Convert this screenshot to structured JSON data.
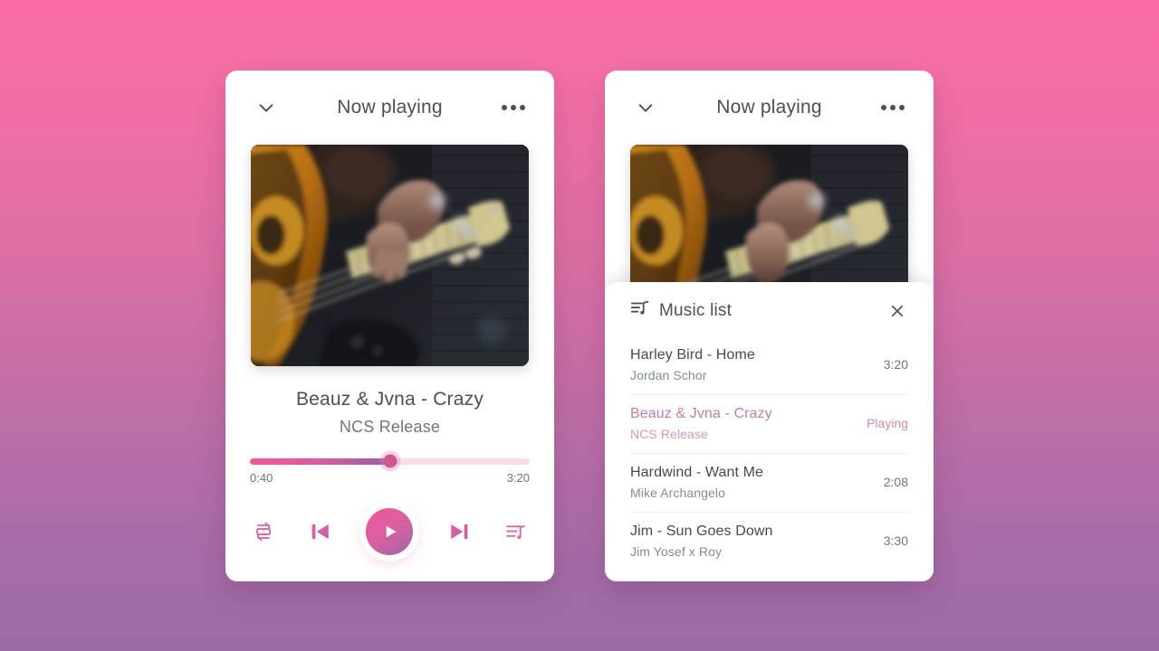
{
  "background": {
    "gradient_from": "#fa6ea5",
    "gradient_to": "#9b6ca9"
  },
  "accent": {
    "pink": "#f8569a",
    "purple": "#9b5fa6",
    "playing": "#c17fa5"
  },
  "player": {
    "header": {
      "title": "Now playing",
      "collapse_icon": "chevron-down-icon",
      "more_icon": "more-options-icon"
    },
    "album_art_alt": "bass-guitar-photo",
    "track": {
      "title": "Beauz & Jvna - Crazy",
      "artist": "NCS Release"
    },
    "progress": {
      "elapsed": "0:40",
      "duration": "3:20",
      "percent": 50
    },
    "controls": {
      "repeat_label": "repeat-one",
      "previous_label": "skip-previous",
      "play_label": "play",
      "next_label": "skip-next",
      "playlist_label": "playlist"
    }
  },
  "music_list": {
    "title": "Music list",
    "icon": "queue-music-icon",
    "close_icon": "close-icon",
    "songs": [
      {
        "name": "Harley Bird - Home",
        "artist": "Jordan Schor",
        "meta": "3:20",
        "playing": false
      },
      {
        "name": "Beauz & Jvna - Crazy",
        "artist": "NCS Release",
        "meta": "Playing",
        "playing": true
      },
      {
        "name": "Hardwind - Want Me",
        "artist": "Mike Archangelo",
        "meta": "2:08",
        "playing": false
      },
      {
        "name": "Jim - Sun Goes Down",
        "artist": "Jim Yosef x Roy",
        "meta": "3:30",
        "playing": false
      }
    ]
  }
}
